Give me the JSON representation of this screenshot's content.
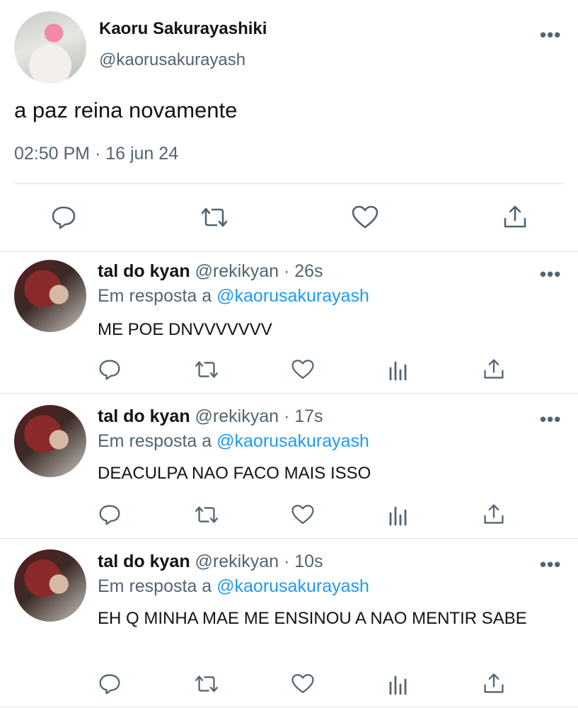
{
  "tweet": {
    "author_name": "Kaoru Sakurayashiki",
    "author_handle": "@kaorusakurayash",
    "text": "a paz reina novamente",
    "timestamp": "02:50 PM · 16 jun 24",
    "more_icon": "more-dots-icon",
    "actions": [
      "reply-icon",
      "retweet-icon",
      "like-icon",
      "share-icon"
    ]
  },
  "replies": [
    {
      "name": "tal do kyan",
      "meta": "@rekikyan · 26s",
      "reply_prefix": "Em resposta a",
      "mention": "@kaorusakurayash",
      "text": "ME POE DNVVVVVVV"
    },
    {
      "name": "tal do kyan",
      "meta": "@rekikyan · 17s",
      "reply_prefix": "Em resposta a",
      "mention": "@kaorusakurayash",
      "text": "DEACULPA NAO FACO MAIS ISSO"
    },
    {
      "name": "tal do kyan",
      "meta": "@rekikyan · 10s",
      "reply_prefix": "Em resposta a",
      "mention": "@kaorusakurayash",
      "text": "EH Q MINHA MAE ME ENSINOU A NAO MENTIR SABE"
    }
  ],
  "colors": {
    "text": "#0f1419",
    "secondary": "#536471",
    "link": "#1d9bf0"
  }
}
